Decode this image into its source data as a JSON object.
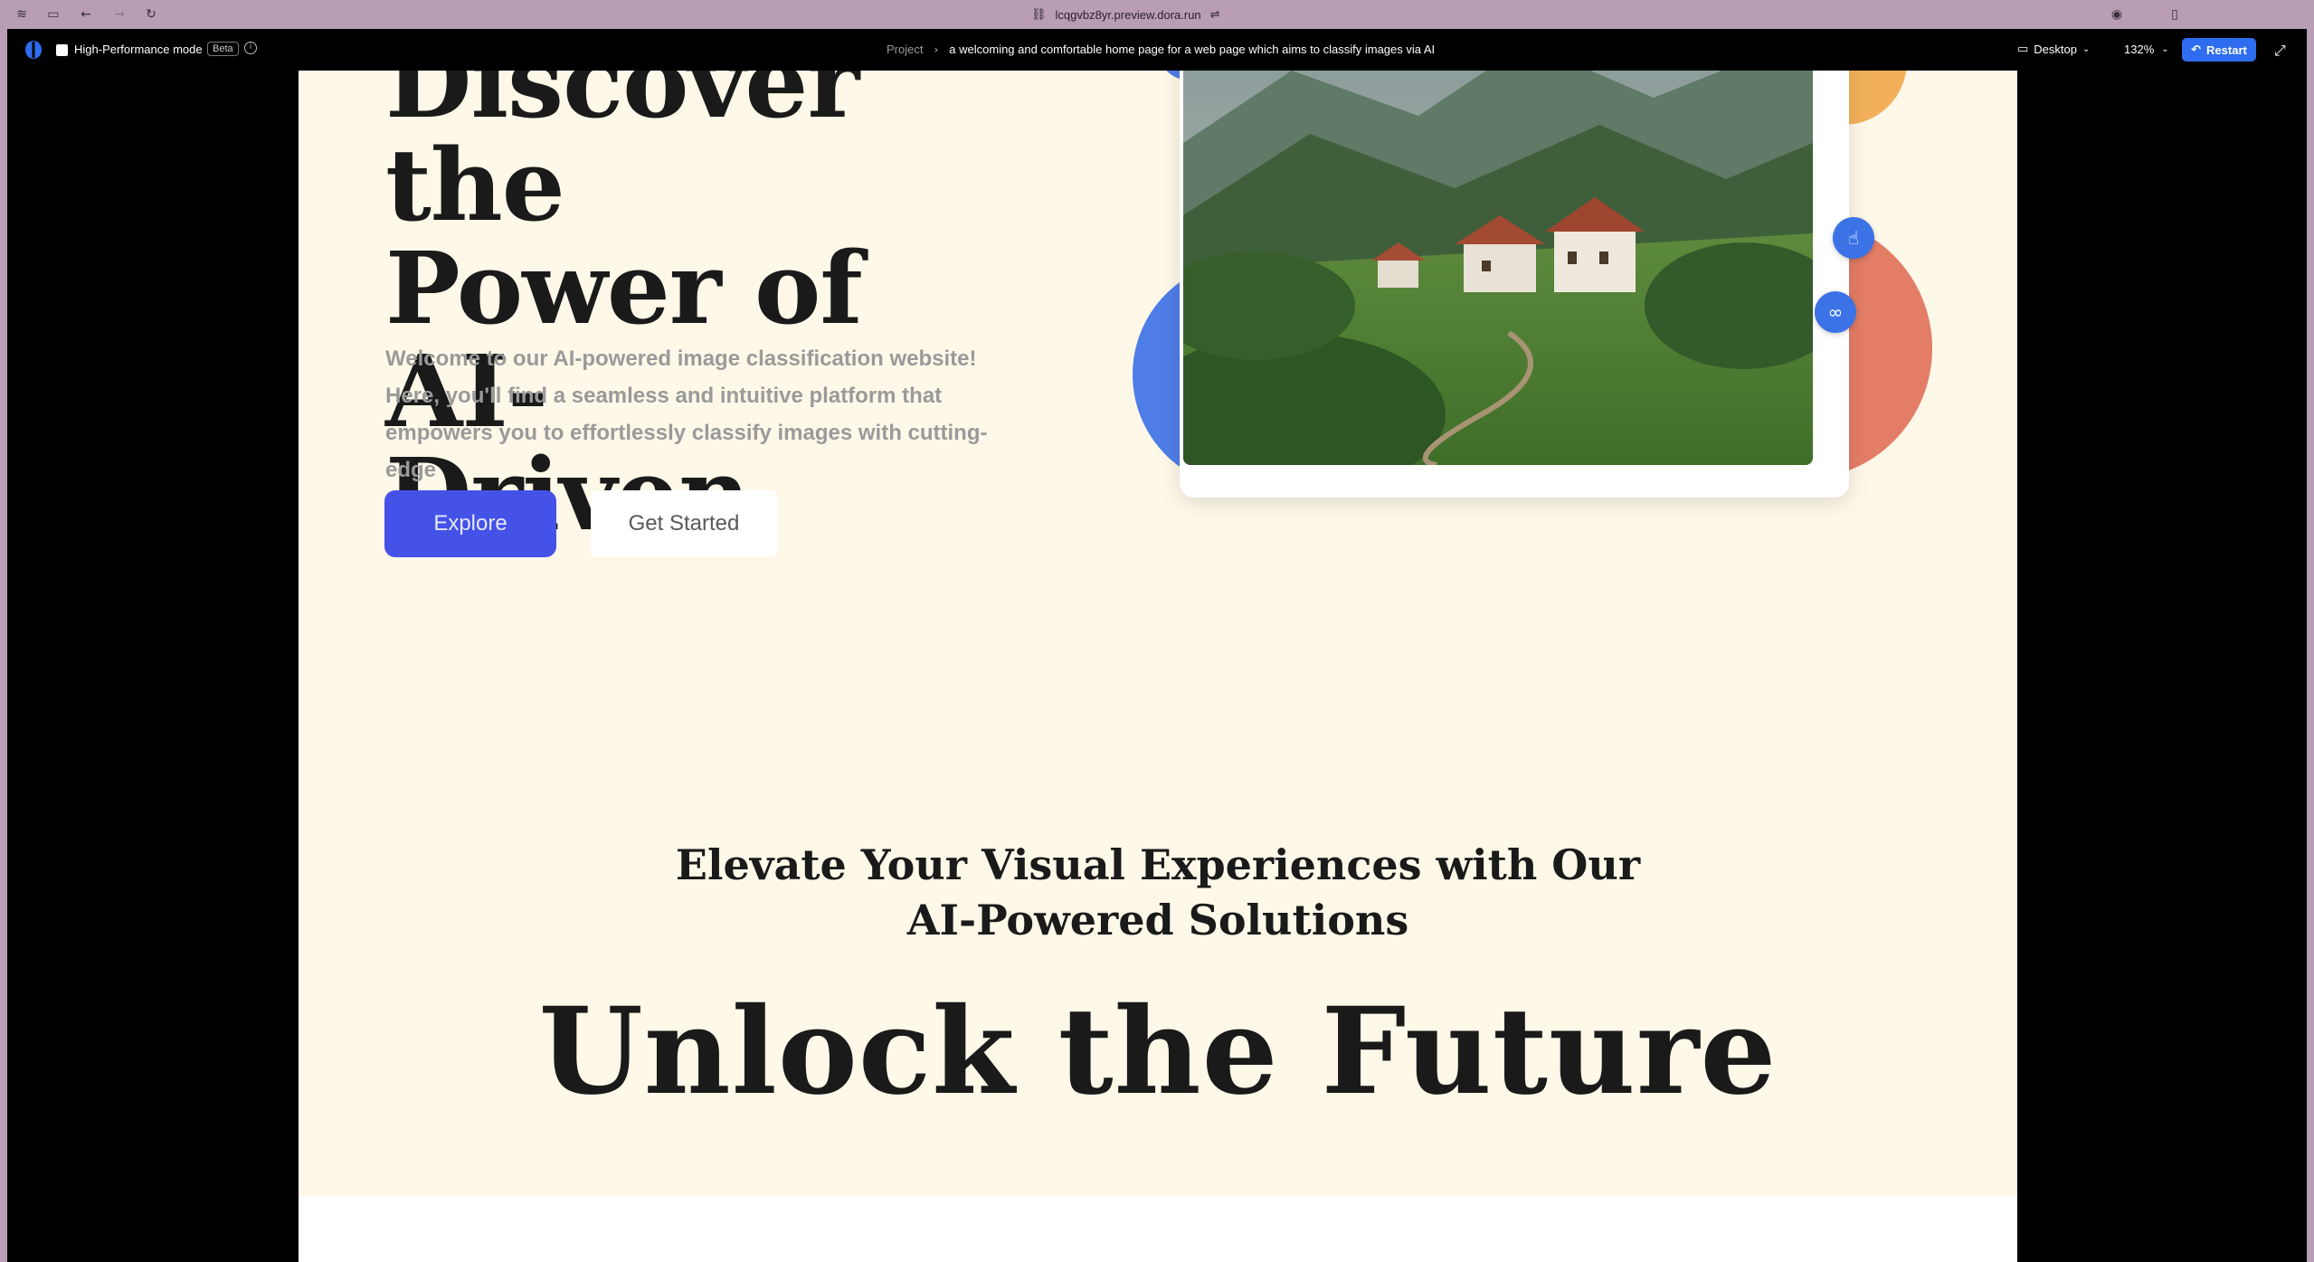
{
  "browser": {
    "url": "lcqgvbz8yr.preview.dora.run"
  },
  "toolbar": {
    "mode_label": "High-Performance mode",
    "beta_badge": "Beta",
    "breadcrumb_project": "Project",
    "breadcrumb_title": "a welcoming and comfortable home page for a web page which aims to classify images via AI",
    "device_label": "Desktop",
    "zoom_label": "132%",
    "restart_label": "Restart"
  },
  "hero": {
    "title_line1": "Discover the",
    "title_line2": "Power of AI-",
    "title_line3": "Driven",
    "subtitle": "Welcome to our AI-powered image classification website! Here, you'll find a seamless and intuitive platform that empowers you to effortlessly classify images with cutting-edge",
    "explore_label": "Explore",
    "get_started_label": "Get Started"
  },
  "section": {
    "heading": "Elevate Your Visual Experiences with Our AI-Powered Solutions",
    "big_heading": "Unlock the Future"
  },
  "colors": {
    "accent": "#4452e8",
    "restart": "#2f6df0",
    "page_bg": "#fdf8e8",
    "circle_blue": "#4f7de8",
    "circle_red": "#e47d66",
    "circle_yellow": "#f2b05a"
  },
  "icons": {
    "fab_top": "hand-sparkle-icon",
    "fab_bottom": "link-icon"
  }
}
